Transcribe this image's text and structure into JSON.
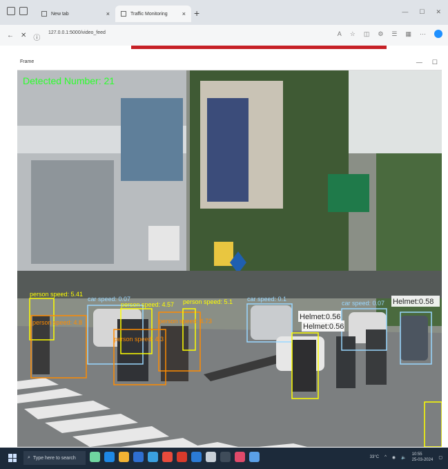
{
  "browser": {
    "tabs": [
      {
        "label": "New tab"
      },
      {
        "label": "Traffic Monitoring"
      }
    ],
    "url": "127.0.0.1:5000/video_feed"
  },
  "app_window": {
    "title": "Frame"
  },
  "video": {
    "overlay_text": "Detected Number: 21",
    "detections": [
      {
        "label": "person speed: 5.41",
        "color": "#ffff00"
      },
      {
        "label": "person speed: 4.8",
        "color": "#ff8c00"
      },
      {
        "label": "car speed: 0.07",
        "color": "#9ad7ff"
      },
      {
        "label": "person speed: 4.57",
        "color": "#ffff00"
      },
      {
        "label": "person speed: 4.3",
        "color": "#ff8c00"
      },
      {
        "label": "person speed: 4.73",
        "color": "#ff8c00"
      },
      {
        "label": "person speed: 5.1",
        "color": "#ffff00"
      },
      {
        "label": "car speed: 0.1",
        "color": "#9ad7ff"
      },
      {
        "label": "Helmet:0.56",
        "color": "#ffffff"
      },
      {
        "label": "Helmet:0.56",
        "color": "#ffffff"
      },
      {
        "label": "car speed: 0.07",
        "color": "#9ad7ff"
      },
      {
        "label": "Helmet:0.58",
        "color": "#ffffff"
      }
    ]
  },
  "taskbar": {
    "search_placeholder": "Type here to search",
    "temperature": "33°C",
    "time": "10:55",
    "date": "25-03-2024"
  }
}
